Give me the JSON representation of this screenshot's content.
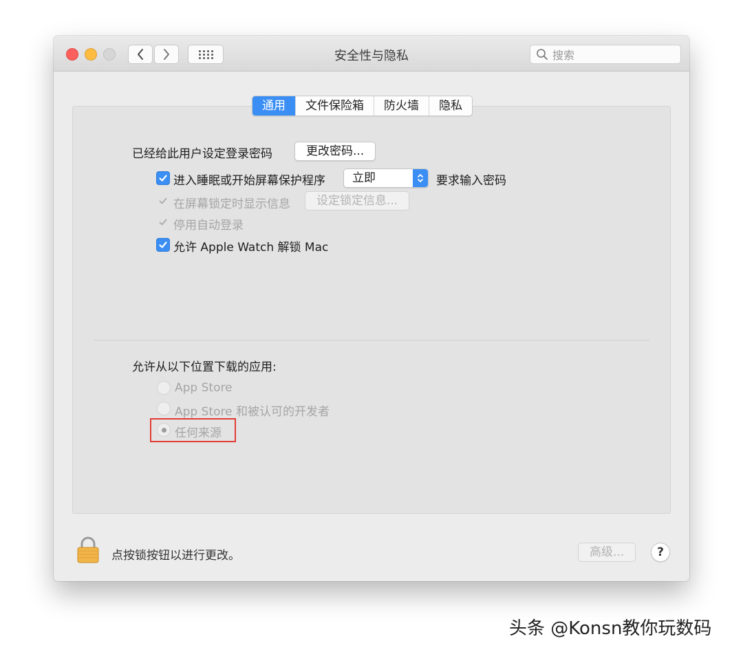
{
  "window": {
    "title": "安全性与隐私",
    "search_placeholder": "搜索"
  },
  "tabs": [
    {
      "label": "通用",
      "active": true
    },
    {
      "label": "文件保险箱",
      "active": false
    },
    {
      "label": "防火墙",
      "active": false
    },
    {
      "label": "隐私",
      "active": false
    }
  ],
  "general": {
    "password_label": "已经给此用户设定登录密码",
    "change_password_button": "更改密码...",
    "require_password": {
      "checked": true,
      "prefix": "进入睡眠或开始屏幕保护程序",
      "select_value": "立即",
      "suffix": "要求输入密码"
    },
    "show_message": {
      "checked": true,
      "disabled": true,
      "label": "在屏幕锁定时显示信息",
      "button": "设定锁定信息..."
    },
    "disable_auto_login": {
      "checked": true,
      "disabled": true,
      "label": "停用自动登录"
    },
    "apple_watch_unlock": {
      "checked": true,
      "label": "允许 Apple Watch 解锁 Mac"
    }
  },
  "downloads": {
    "heading": "允许从以下位置下载的应用:",
    "options": [
      {
        "label": "App Store",
        "selected": false
      },
      {
        "label": "App Store 和被认可的开发者",
        "selected": false
      },
      {
        "label": "任何来源",
        "selected": true
      }
    ],
    "highlight_color": "#e23b35"
  },
  "footer": {
    "lock_text": "点按锁按钮以进行更改。",
    "advanced_button": "高级...",
    "help_button": "?"
  },
  "watermark": "头条 @Konsn教你玩数码",
  "colors": {
    "accent": "#3a8ef4",
    "close": "#fc605c",
    "minimize": "#fdbc40",
    "zoom": "#d6d6d6"
  }
}
